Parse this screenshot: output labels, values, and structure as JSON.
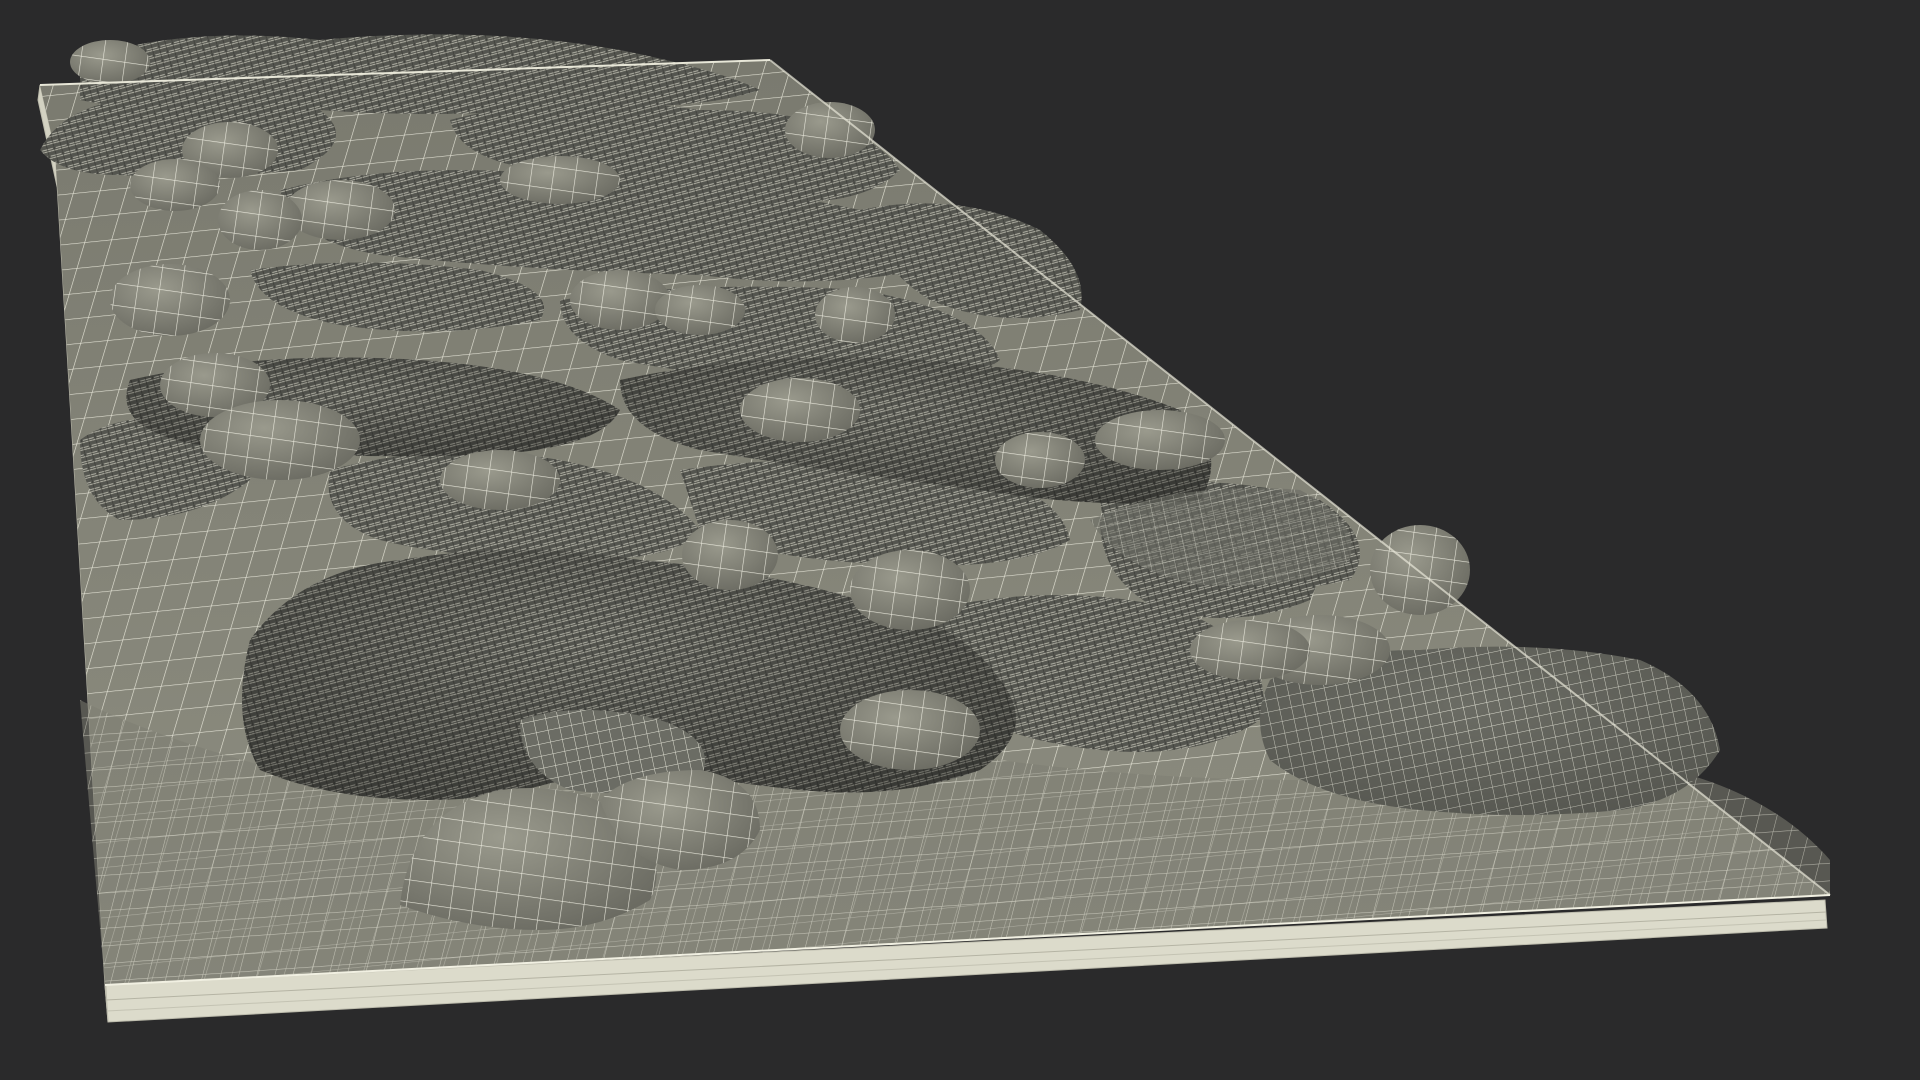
{
  "scene": {
    "background_color": "#2a2a2b",
    "base_fill_color": "#858578",
    "base_side_color": "#d9d8c8",
    "wire_color": "#efeee0",
    "moss_fill_color": "#5b5c55",
    "moss_light_color": "#7b7c73",
    "stone_fill_color": "#8e8e82",
    "stone_shade_color": "#6e6e64",
    "render_mode": "wireframe-over-shaded",
    "subject": "moss-and-stone-terrain-panel"
  }
}
